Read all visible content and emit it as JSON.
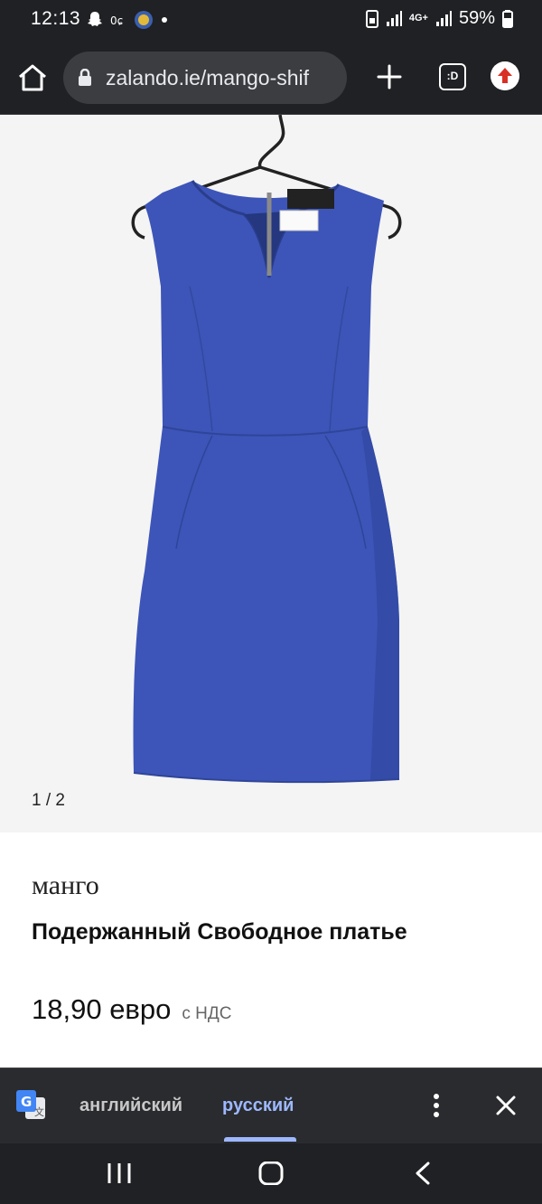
{
  "status_bar": {
    "time": "12:13",
    "battery": "59%",
    "network": "4G+"
  },
  "browser": {
    "url": "zalando.ie/mango-shif",
    "tab_count": ":D",
    "icons": [
      "home-icon",
      "lock-icon",
      "plus-icon",
      "tabs-icon",
      "update-icon"
    ]
  },
  "product": {
    "gallery_counter": "1 / 2",
    "brand": "манго",
    "title": "Подержанный Свободное платье",
    "price": "18,90 евро",
    "vat_note": "с НДС",
    "image_color": "#3d55b8"
  },
  "translate_bar": {
    "source_lang": "английский",
    "target_lang": "русский",
    "active_color": "#9db8ff"
  }
}
